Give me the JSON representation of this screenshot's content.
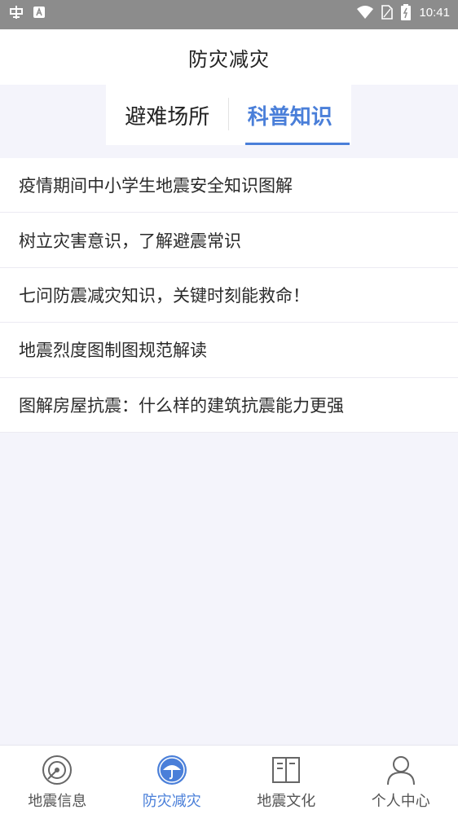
{
  "status_bar": {
    "time": "10:41",
    "icons": [
      "carrier-icon",
      "notification-a-icon",
      "wifi-icon",
      "sim-icon",
      "battery-icon"
    ]
  },
  "header": {
    "title": "防灾减灾"
  },
  "tabs": [
    {
      "label": "避难场所",
      "active": false
    },
    {
      "label": "科普知识",
      "active": true
    }
  ],
  "articles": [
    "疫情期间中小学生地震安全知识图解",
    "树立灾害意识，了解避震常识",
    "七问防震减灾知识，关键时刻能救命！",
    "地震烈度图制图规范解读",
    "图解房屋抗震：什么样的建筑抗震能力更强"
  ],
  "bottom_nav": [
    {
      "label": "地震信息",
      "icon": "radar-icon",
      "active": false
    },
    {
      "label": "防灾减灾",
      "icon": "umbrella-icon",
      "active": true
    },
    {
      "label": "地震文化",
      "icon": "book-icon",
      "active": false
    },
    {
      "label": "个人中心",
      "icon": "person-icon",
      "active": false
    }
  ],
  "colors": {
    "accent": "#4a7fd9",
    "status_bar": "#8c8c8c",
    "background": "#f4f4fb"
  }
}
